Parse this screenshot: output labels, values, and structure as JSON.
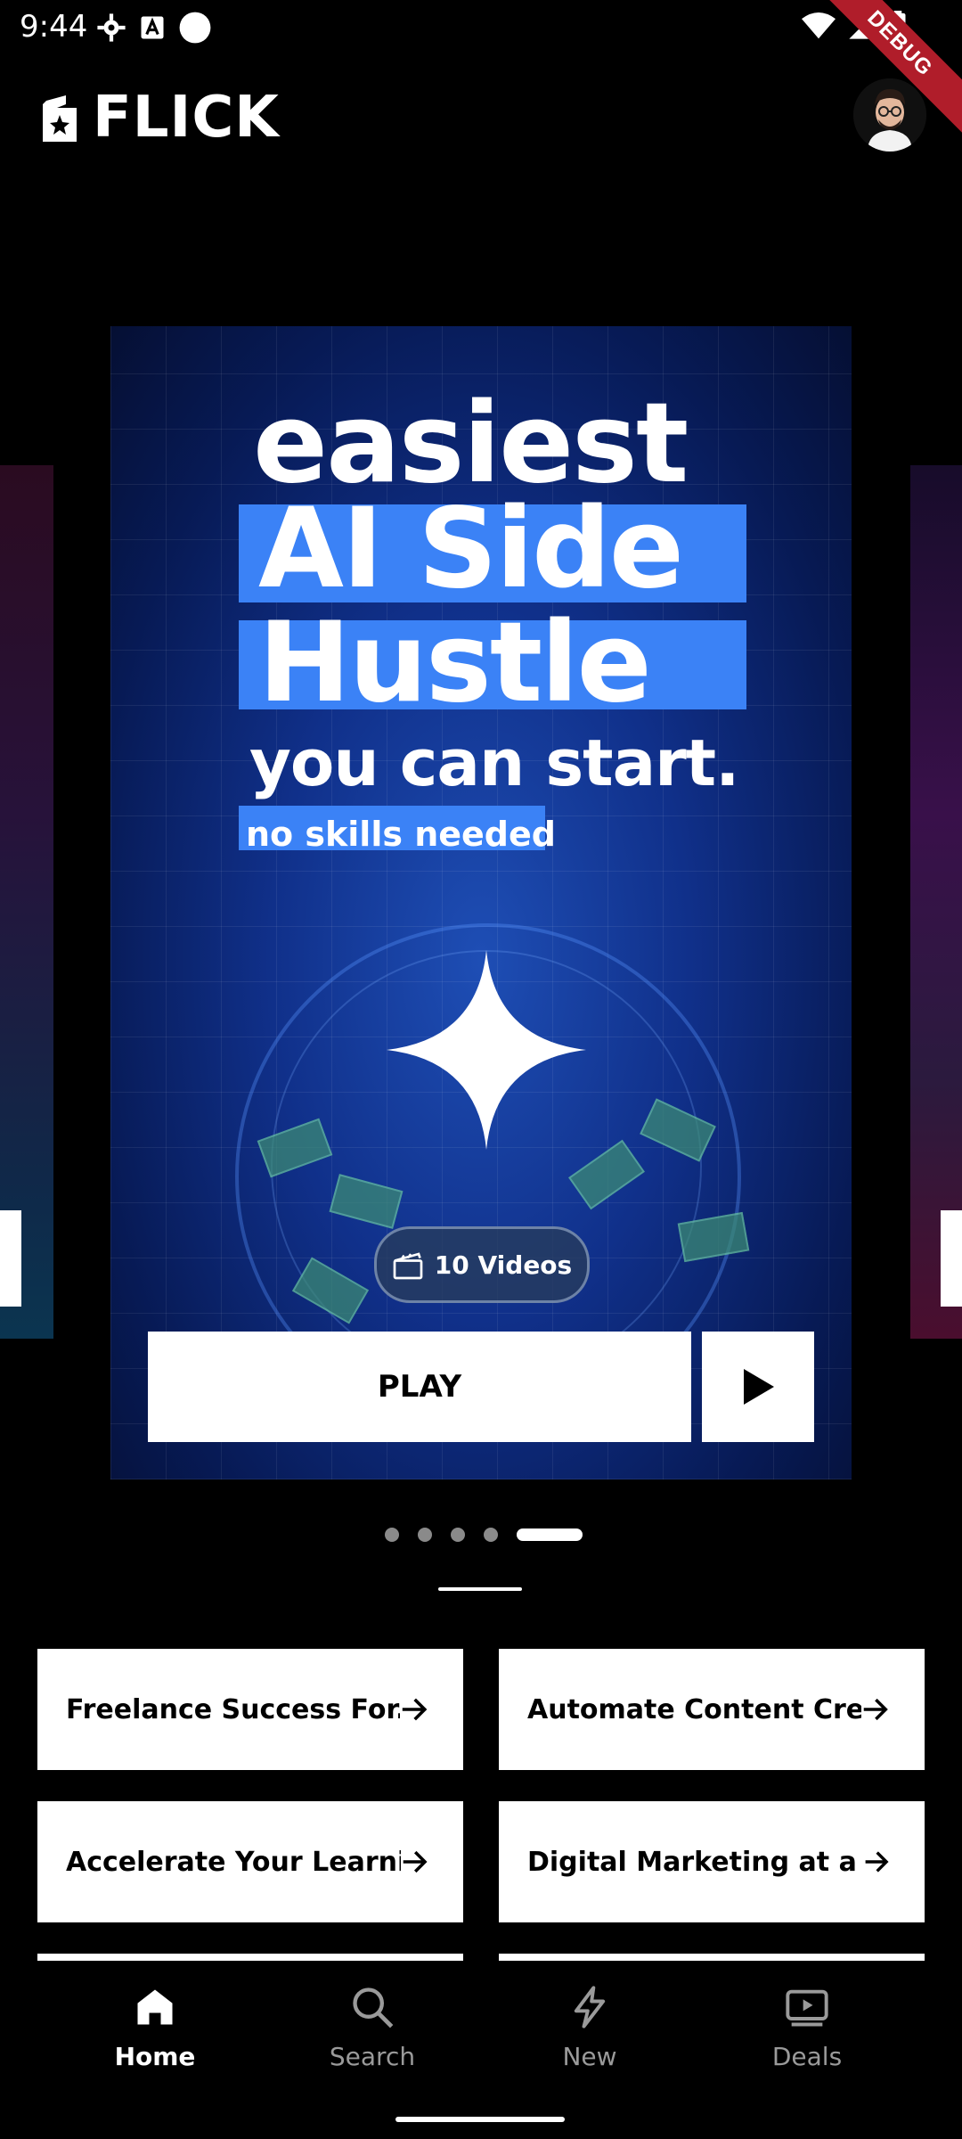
{
  "status_bar": {
    "time": "9:44",
    "icons_left": [
      "settings-icon",
      "a-icon",
      "circle-icon"
    ],
    "icons_right": [
      "wifi-icon",
      "signal-icon",
      "battery-icon"
    ],
    "debug_label": "DEBUG"
  },
  "header": {
    "app_name": "FLICK"
  },
  "hero": {
    "headline_line1": "easiest",
    "headline_line2": "AI Side",
    "headline_line3": "Hustle",
    "headline_line4": "you can start.",
    "headline_tag": "no skills needed",
    "videos_count_label": "10 Videos",
    "play_label": "PLAY"
  },
  "pager": {
    "count": 5,
    "active_index": 4
  },
  "topics": [
    "Freelance Success For...",
    "Automate Content Cre...",
    "Accelerate Your Learni...",
    "Digital Marketing at a c..."
  ],
  "nav": {
    "items": [
      {
        "label": "Home",
        "icon": "home-icon",
        "active": true
      },
      {
        "label": "Search",
        "icon": "search-icon",
        "active": false
      },
      {
        "label": "New",
        "icon": "lightning-icon",
        "active": false
      },
      {
        "label": "Deals",
        "icon": "play-box-icon",
        "active": false
      }
    ]
  },
  "colors": {
    "accent": "#3b82f6",
    "background": "#000000"
  }
}
